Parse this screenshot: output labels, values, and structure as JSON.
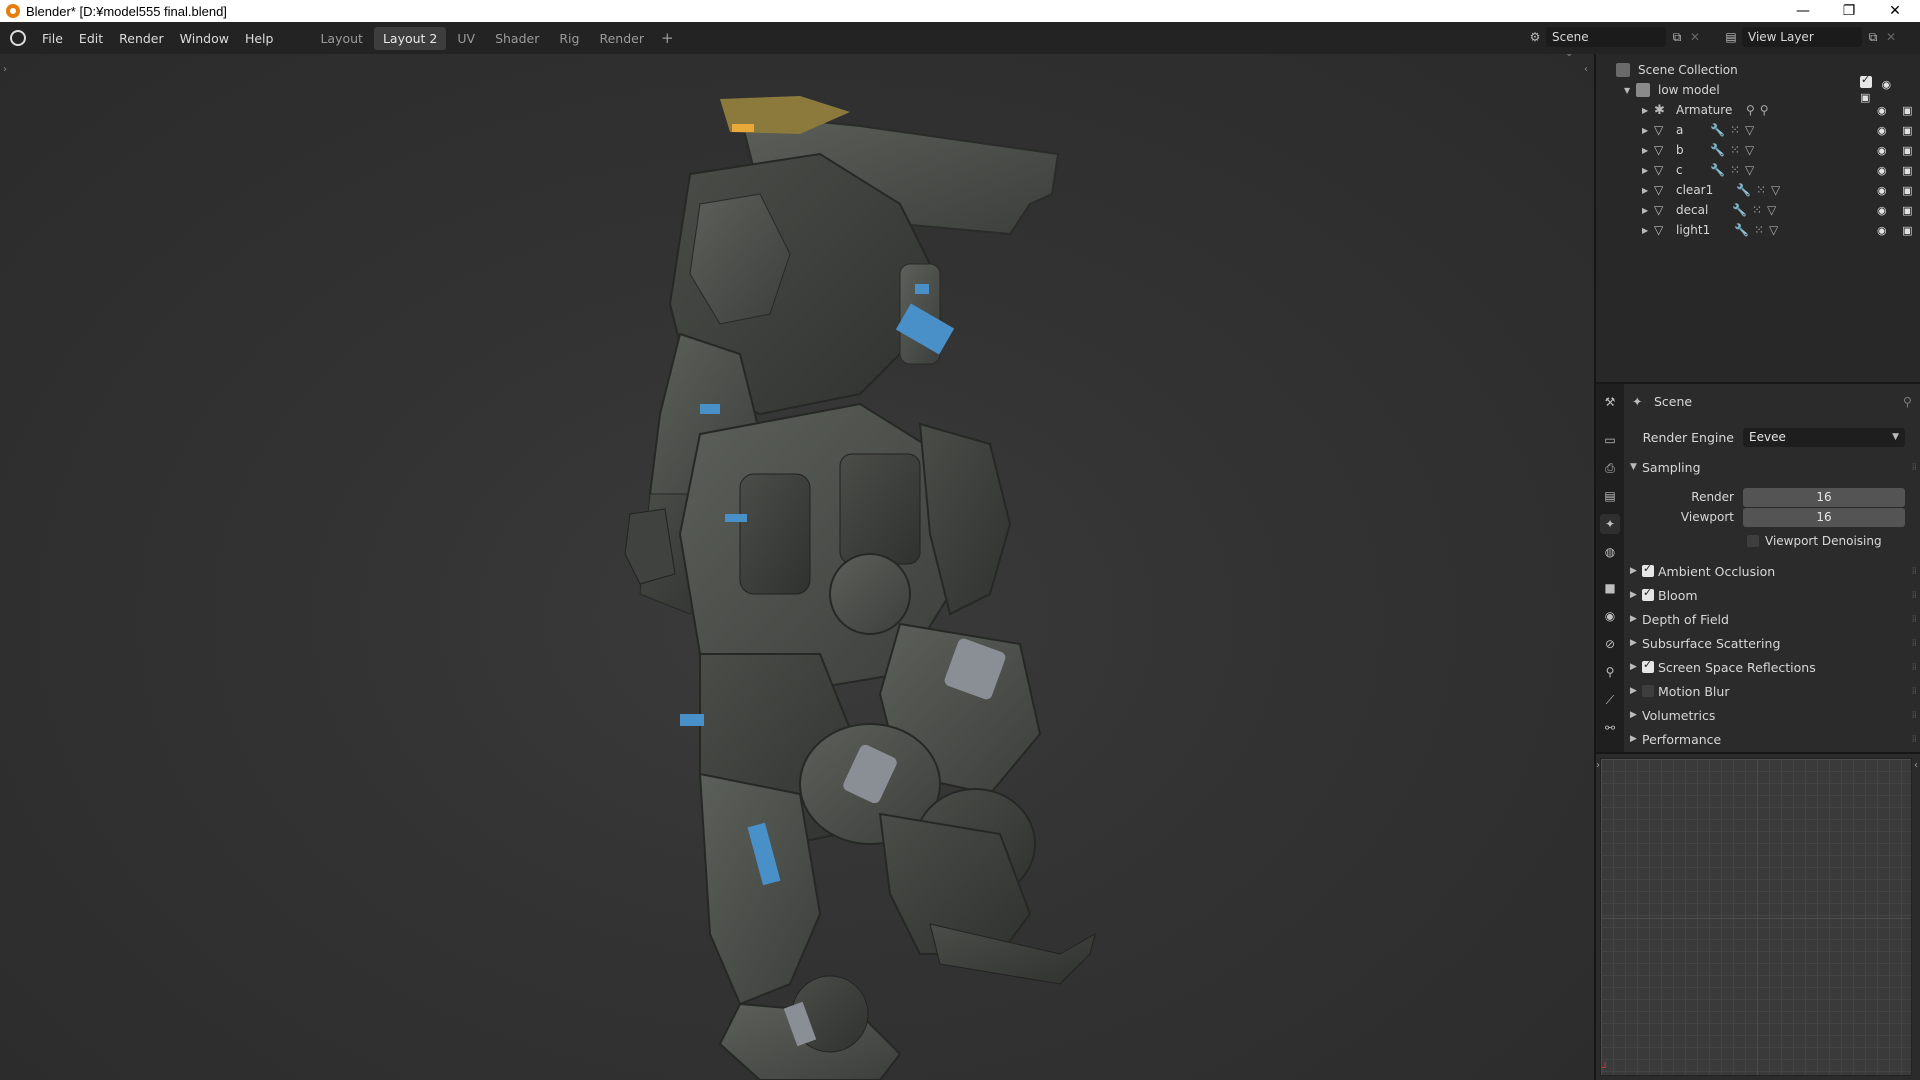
{
  "window": {
    "title": "Blender* [D:¥model555 final.blend]",
    "minimize": "—",
    "maximize": "❐",
    "close": "✕"
  },
  "menu": [
    "File",
    "Edit",
    "Render",
    "Window",
    "Help"
  ],
  "tabs": [
    {
      "label": "Layout",
      "active": false
    },
    {
      "label": "Layout 2",
      "active": true
    },
    {
      "label": "UV",
      "active": false
    },
    {
      "label": "Shader",
      "active": false
    },
    {
      "label": "Rig",
      "active": false
    },
    {
      "label": "Render",
      "active": false
    }
  ],
  "tab_add": "+",
  "scene_selector": {
    "value": "Scene"
  },
  "view_layer_selector": {
    "value": "View Layer"
  },
  "outliner": {
    "root": "Scene Collection",
    "collection": "low model",
    "items": [
      {
        "name": "Armature",
        "type": "armature"
      },
      {
        "name": "a",
        "type": "mesh"
      },
      {
        "name": "b",
        "type": "mesh"
      },
      {
        "name": "c",
        "type": "mesh"
      },
      {
        "name": "clear1",
        "type": "mesh"
      },
      {
        "name": "decal",
        "type": "mesh"
      },
      {
        "name": "light1",
        "type": "mesh"
      }
    ]
  },
  "properties": {
    "context": "Scene",
    "render_engine_label": "Render Engine",
    "render_engine_value": "Eevee",
    "sampling_header": "Sampling",
    "render_label": "Render",
    "render_value": "16",
    "viewport_label": "Viewport",
    "viewport_value": "16",
    "viewport_denoising": "Viewport Denoising",
    "panels": [
      {
        "label": "Ambient Occlusion",
        "checkbox": true,
        "checked": true
      },
      {
        "label": "Bloom",
        "checkbox": true,
        "checked": true
      },
      {
        "label": "Depth of Field",
        "checkbox": false
      },
      {
        "label": "Subsurface Scattering",
        "checkbox": false
      },
      {
        "label": "Screen Space Reflections",
        "checkbox": true,
        "checked": true
      },
      {
        "label": "Motion Blur",
        "checkbox": true,
        "checked": false
      },
      {
        "label": "Volumetrics",
        "checkbox": false
      },
      {
        "label": "Performance",
        "checkbox": false
      }
    ]
  },
  "colors": {
    "accent_orange": "#e87d0d",
    "robot_body": "#4b4e49",
    "robot_accent_blue": "#4a90c8"
  }
}
